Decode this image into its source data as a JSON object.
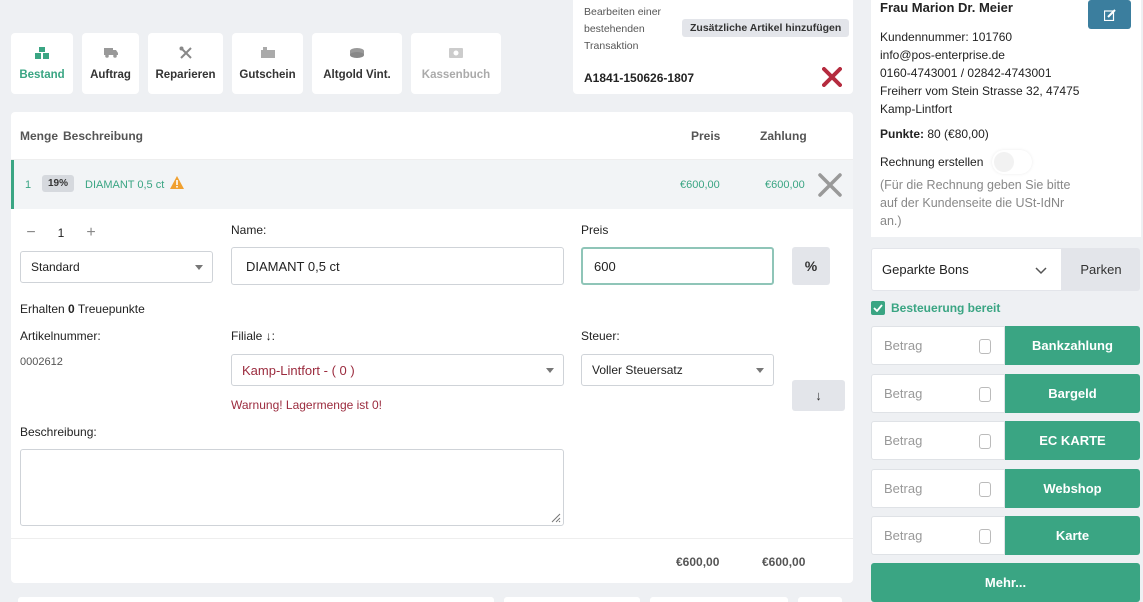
{
  "toolbar": {
    "buttons": [
      {
        "label": "Bestand",
        "icon": "boxes-icon"
      },
      {
        "label": "Auftrag",
        "icon": "truck-icon"
      },
      {
        "label": "Reparieren",
        "icon": "tools-icon"
      },
      {
        "label": "Gutschein",
        "icon": "gift-card-icon"
      },
      {
        "label": "Altgold Vint.",
        "icon": "coins-icon"
      },
      {
        "label": "Kassenbuch",
        "icon": "cash-icon"
      }
    ]
  },
  "transaction": {
    "edit_label": "Bearbeiten einer bestehenden Transaktion",
    "add_articles": "Zusätzliche Artikel hinzufügen",
    "id": "A1841-150626-1807"
  },
  "table": {
    "headers": {
      "qty": "Menge",
      "desc": "Beschreibung",
      "price": "Preis",
      "payment": "Zahlung"
    }
  },
  "line": {
    "qty": "1",
    "vat": "19%",
    "description": "DIAMANT 0,5 ct",
    "price": "€600,00",
    "payment": "€600,00"
  },
  "editor": {
    "quantity": "1",
    "price_type": "Standard",
    "name_label": "Name:",
    "name_value": "DIAMANT 0,5 ct",
    "price_label": "Preis",
    "price_value": "600",
    "percent_label": "%",
    "loyalty_prefix": "Erhalten",
    "loyalty_points": "0",
    "loyalty_suffix": "Treuepunkte",
    "article_label": "Artikelnummer:",
    "article_value": "0002612",
    "branch_label": "Filiale ↓:",
    "branch_value": "Kamp-Lintfort - ( 0 )",
    "tax_label": "Steuer:",
    "tax_value": "Voller Steuersatz",
    "down_label": "↓",
    "warning": "Warnung! Lagermenge ist 0!",
    "desc_label": "Beschreibung:"
  },
  "totals": {
    "price": "€600,00",
    "payment": "€600,00"
  },
  "customer": {
    "name": "Frau Marion Dr. Meier",
    "lines": [
      "Kundennummer: 101760",
      "info@pos-enterprise.de",
      "0160-4743001 / 02842-4743001",
      "Freiherr vom Stein Strasse 32, 47475",
      "Kamp-Lintfort"
    ],
    "points_label": "Punkte:",
    "points_value": "80 (€80,00)",
    "invoice_label": "Rechnung erstellen",
    "invoice_hint": "(Für die Rechnung geben Sie bitte auf der Kundenseite die USt-IdNr an.)"
  },
  "parked": {
    "label": "Geparkte Bons",
    "park_button": "Parken"
  },
  "tax_ready": "Besteuerung bereit",
  "payments": {
    "placeholder": "Betrag",
    "methods": [
      "Bankzahlung",
      "Bargeld",
      "EC KARTE",
      "Webshop",
      "Karte"
    ]
  },
  "more": "Mehr...",
  "colors": {
    "accent": "#3aa583",
    "edit": "#3b7e9e",
    "warning": "#9b2b3e",
    "danger": "#b52b3e"
  }
}
